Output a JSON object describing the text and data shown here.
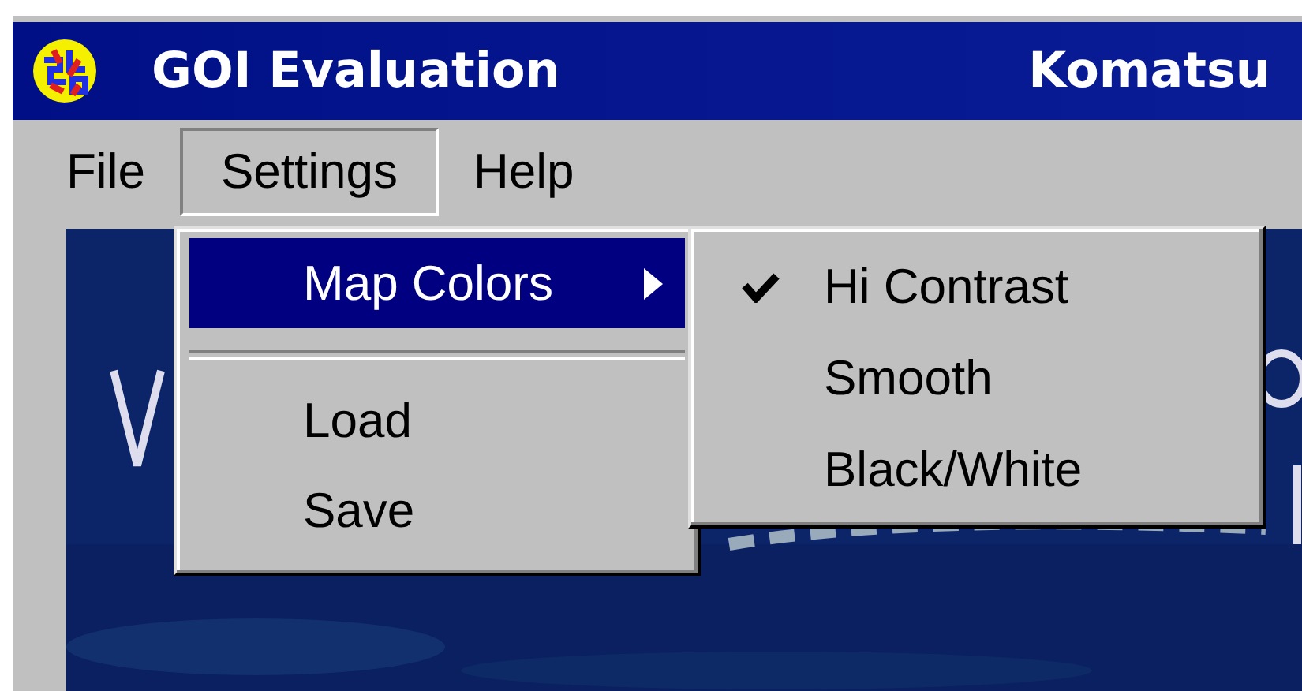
{
  "window": {
    "title": "GOI Evaluation",
    "title_right": "Komatsu"
  },
  "menu_bar": [
    {
      "label": "File",
      "selected": false
    },
    {
      "label": "Settings",
      "selected": true
    },
    {
      "label": "Help",
      "selected": false
    }
  ],
  "settings_menu": [
    {
      "kind": "submenu",
      "label": "Map Colors",
      "selected": true
    },
    {
      "kind": "separator"
    },
    {
      "kind": "item",
      "label": "Load",
      "selected": false
    },
    {
      "kind": "item",
      "label": "Save",
      "selected": false
    }
  ],
  "map_colors_menu": [
    {
      "label": "Hi Contrast",
      "checked": true
    },
    {
      "label": "Smooth",
      "checked": false
    },
    {
      "label": "Black/White",
      "checked": false
    }
  ]
}
